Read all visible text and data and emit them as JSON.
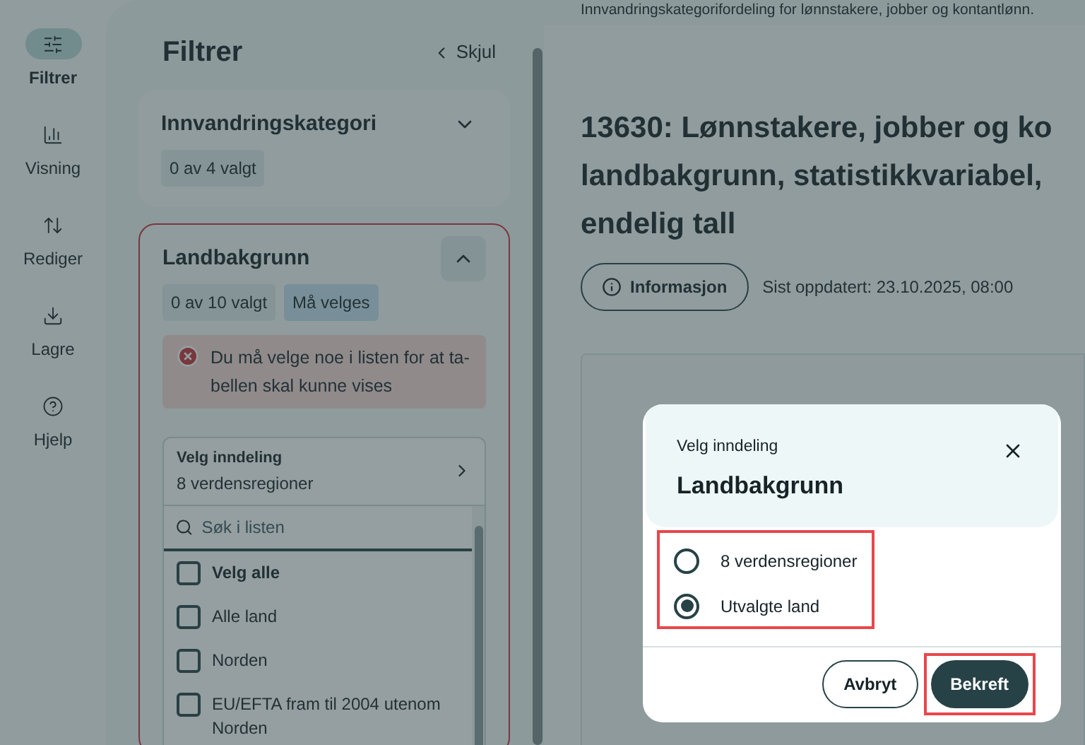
{
  "nav": [
    {
      "label": "Filtrer",
      "selected": true
    },
    {
      "label": "Visning",
      "selected": false
    },
    {
      "label": "Rediger",
      "selected": false
    },
    {
      "label": "Lagre",
      "selected": false
    },
    {
      "label": "Hjelp",
      "selected": false
    }
  ],
  "filter_panel": {
    "title": "Filtrer",
    "hide_link": "Skjul",
    "sections": [
      {
        "title": "Innvandringskategori",
        "expanded": false,
        "error": false,
        "badges": [
          {
            "text": "0 av 4 valgt",
            "kind": "count"
          }
        ]
      },
      {
        "title": "Landbakgrunn",
        "expanded": true,
        "error": true,
        "badges": [
          {
            "text": "0 av 10 valgt",
            "kind": "count"
          },
          {
            "text": "Må velges",
            "kind": "required"
          }
        ],
        "error_message": "Du må velge noe i listen for at ta-\nbellen skal kunne vises",
        "grouping": {
          "label": "Velg inndeling",
          "value": "8 verdensregioner"
        },
        "search": {
          "placeholder": "Søk i listen"
        },
        "options": [
          {
            "label": "Velg alle",
            "checked": false,
            "kind": "select_all"
          },
          {
            "label": "Alle land",
            "checked": false,
            "kind": "option"
          },
          {
            "label": "Norden",
            "checked": false,
            "kind": "option"
          },
          {
            "label": "EU/EFTA fram til 2004 utenom\nNorden",
            "checked": false,
            "kind": "option"
          }
        ]
      }
    ]
  },
  "main": {
    "subtitle": "Innvandringskategorifordeling for lønnstakere, jobber og kontantlønn.",
    "title_lines": [
      "13630: Lønnstakere, jobber og ko",
      "landbakgrunn, statistikkvariabel,",
      "endelig tall"
    ],
    "info_button": "Informasjon",
    "updated": "Sist oppdatert: 23.10.2025, 08:00"
  },
  "dialog": {
    "overline": "Velg inndeling",
    "title": "Landbakgrunn",
    "options": [
      {
        "label": "8 verdensregioner",
        "selected": false
      },
      {
        "label": "Utvalgte land",
        "selected": true
      }
    ],
    "buttons": [
      {
        "label": "Avbryt",
        "kind": "secondary"
      },
      {
        "label": "Bekreft",
        "kind": "primary"
      }
    ]
  }
}
